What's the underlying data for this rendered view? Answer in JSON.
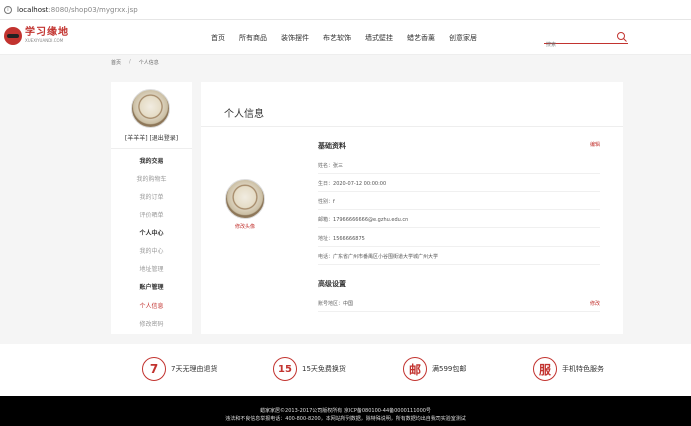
{
  "browser": {
    "url_host": "localhost",
    "url_path": ":8080/shop03/mygrxx.jsp",
    "info_icon": "i"
  },
  "header": {
    "logo_text": "学习缘地",
    "logo_sub": "XUEXIYUANDI.COM",
    "nav": [
      "首页",
      "所有商品",
      "装饰摆件",
      "布艺软饰",
      "墙式壁挂",
      "蜡艺香薰",
      "创意家居"
    ],
    "search_placeholder": "搜索"
  },
  "breadcrumb": {
    "home": "首页",
    "sep": "/",
    "current": "个人信息"
  },
  "sidebar": {
    "user": "[羊羊羊]   [退出登录]",
    "items": [
      {
        "label": "我的交易",
        "type": "head"
      },
      {
        "label": "我的购物车",
        "type": "link"
      },
      {
        "label": "我的订单",
        "type": "link"
      },
      {
        "label": "评价晒单",
        "type": "link"
      },
      {
        "label": "个人中心",
        "type": "head"
      },
      {
        "label": "我的中心",
        "type": "link"
      },
      {
        "label": "地址管理",
        "type": "link"
      },
      {
        "label": "账户管理",
        "type": "head"
      },
      {
        "label": "个人信息",
        "type": "active"
      },
      {
        "label": "修改密码",
        "type": "link"
      }
    ]
  },
  "profile": {
    "title": "个人信息",
    "change_avatar": "修改头像",
    "basic_title": "基础资料",
    "edit": "编辑",
    "fields": [
      {
        "label": "姓名：",
        "value": "张三"
      },
      {
        "label": "生日：",
        "value": "2020-07-12 00:00:00"
      },
      {
        "label": "性别：",
        "value": "f"
      },
      {
        "label": "邮箱：",
        "value": "17966666666@e.gzhu.edu.cn"
      },
      {
        "label": "地址：",
        "value": "1566666875"
      },
      {
        "label": "电话：",
        "value": "广东省广州市番禺区小谷围街道大学城广州大学"
      }
    ],
    "advanced_title": "高级设置",
    "advanced_field": {
      "label": "账号地区：",
      "value": "中国"
    },
    "modify": "修改"
  },
  "features": [
    {
      "icon": "7",
      "label": "7天无理由退货"
    },
    {
      "icon": "15",
      "label": "15天免费换货"
    },
    {
      "icon": "邮",
      "label": "满599包邮"
    },
    {
      "icon": "服",
      "label": "手机特色服务"
    }
  ],
  "footer": {
    "line1": "蜡家家居©2013-2017公司版权所有 京ICP备080100-44备0000111000号",
    "line2": "违法和不良信息举报电话：400-800-8200，本网站所列数据，除特殊说明，所有数据均出自我司实验室测试"
  },
  "colors": {
    "accent": "#c2332f"
  }
}
